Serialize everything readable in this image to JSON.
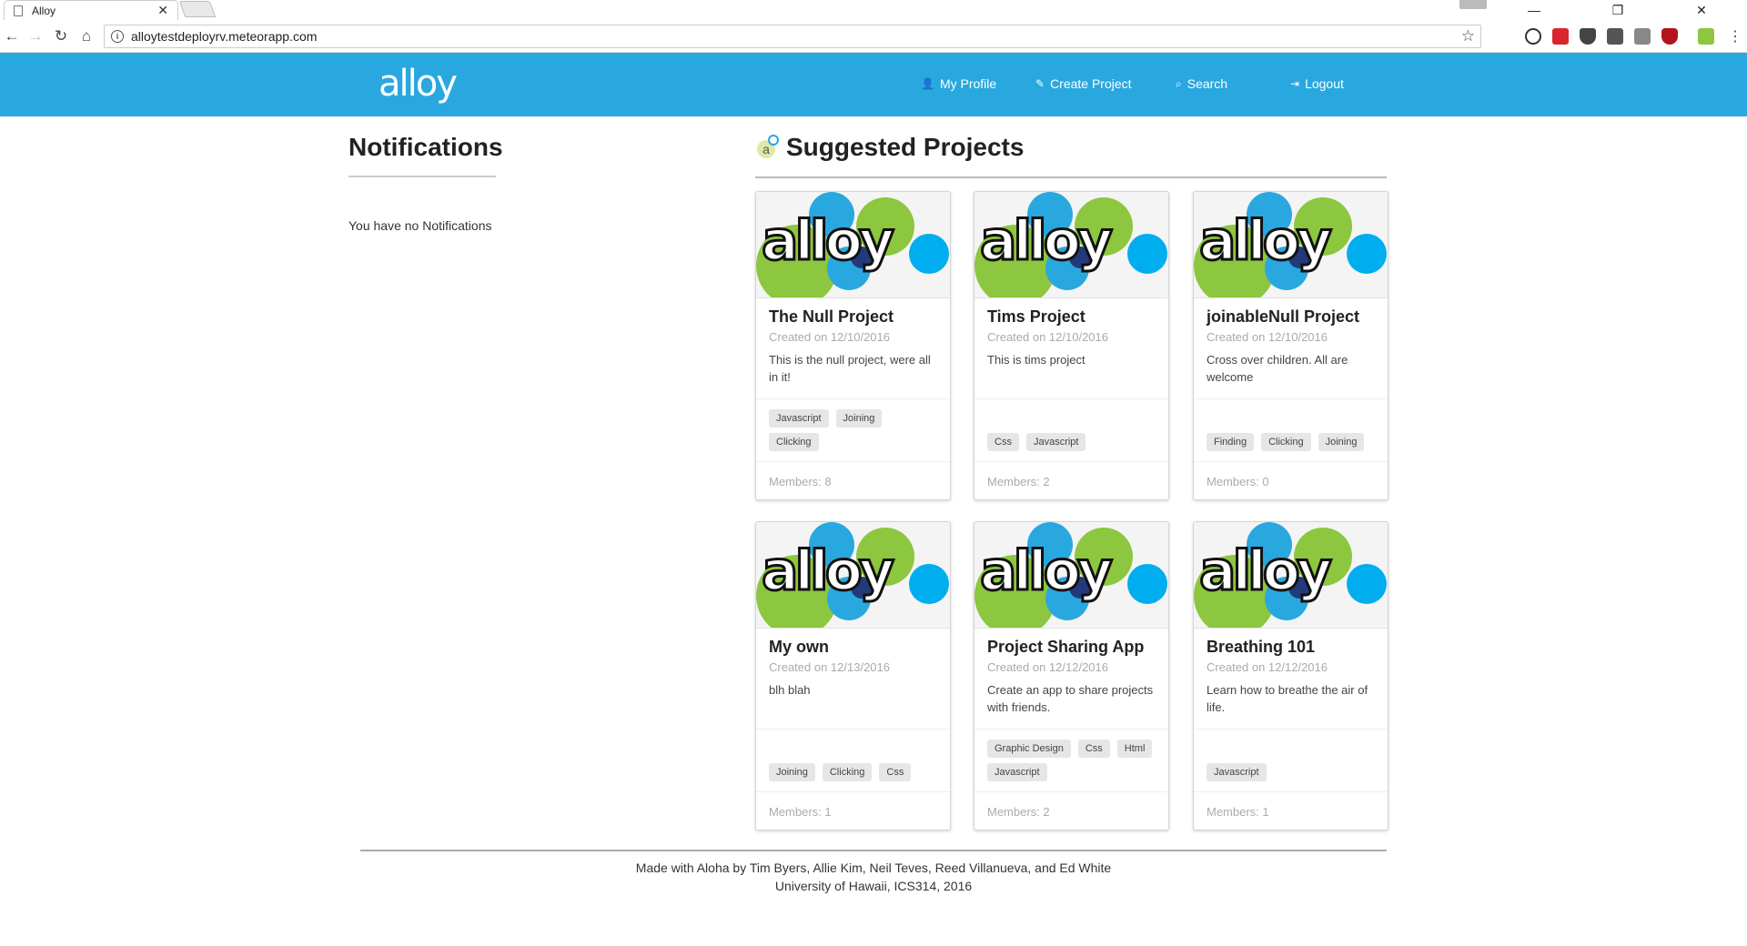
{
  "browser": {
    "tab_title": "Alloy",
    "tab_close": "✕",
    "url": "alloytestdeployrv.meteorapp.com",
    "controls": {
      "minimize": "—",
      "restore": "❐",
      "close": "✕"
    }
  },
  "header": {
    "logo": "alloy",
    "nav": {
      "profile": "My Profile",
      "create": "Create Project",
      "search": "Search",
      "logout": "Logout"
    }
  },
  "notifications": {
    "title": "Notifications",
    "empty_text": "You have no Notifications"
  },
  "suggested": {
    "title": "Suggested Projects",
    "cards": [
      {
        "title": "The Null Project",
        "date": "Created on 12/10/2016",
        "desc": "This is the null project, were all in it!",
        "tags": [
          "Javascript",
          "Joining",
          "Clicking"
        ],
        "members": "Members: 8"
      },
      {
        "title": "Tims Project",
        "date": "Created on 12/10/2016",
        "desc": "This is tims project",
        "tags": [
          "Css",
          "Javascript"
        ],
        "members": "Members: 2"
      },
      {
        "title": "joinableNull Project",
        "date": "Created on 12/10/2016",
        "desc": "Cross over children. All are welcome",
        "tags": [
          "Finding",
          "Clicking",
          "Joining"
        ],
        "members": "Members: 0"
      },
      {
        "title": "My own",
        "date": "Created on 12/13/2016",
        "desc": "blh blah",
        "tags": [
          "Joining",
          "Clicking",
          "Css"
        ],
        "members": "Members: 1"
      },
      {
        "title": "Project Sharing App",
        "date": "Created on 12/12/2016",
        "desc": "Create an app to share projects with friends.",
        "tags": [
          "Graphic Design",
          "Css",
          "Html",
          "Javascript"
        ],
        "members": "Members: 2"
      },
      {
        "title": "Breathing 101",
        "date": "Created on 12/12/2016",
        "desc": "Learn how to breathe the air of life.",
        "tags": [
          "Javascript"
        ],
        "members": "Members: 1"
      }
    ],
    "card_logo_text": "alloy"
  },
  "footer": {
    "line1": "Made with Aloha by Tim Byers, Allie Kim, Neil Teves, Reed Villanueva, and Ed White",
    "line2": "University of Hawaii, ICS314, 2016"
  },
  "colors": {
    "brand_blue": "#29a8e0",
    "logo_green": "#8dc63f",
    "logo_blue": "#00aeef",
    "logo_dark": "#233a7a"
  }
}
